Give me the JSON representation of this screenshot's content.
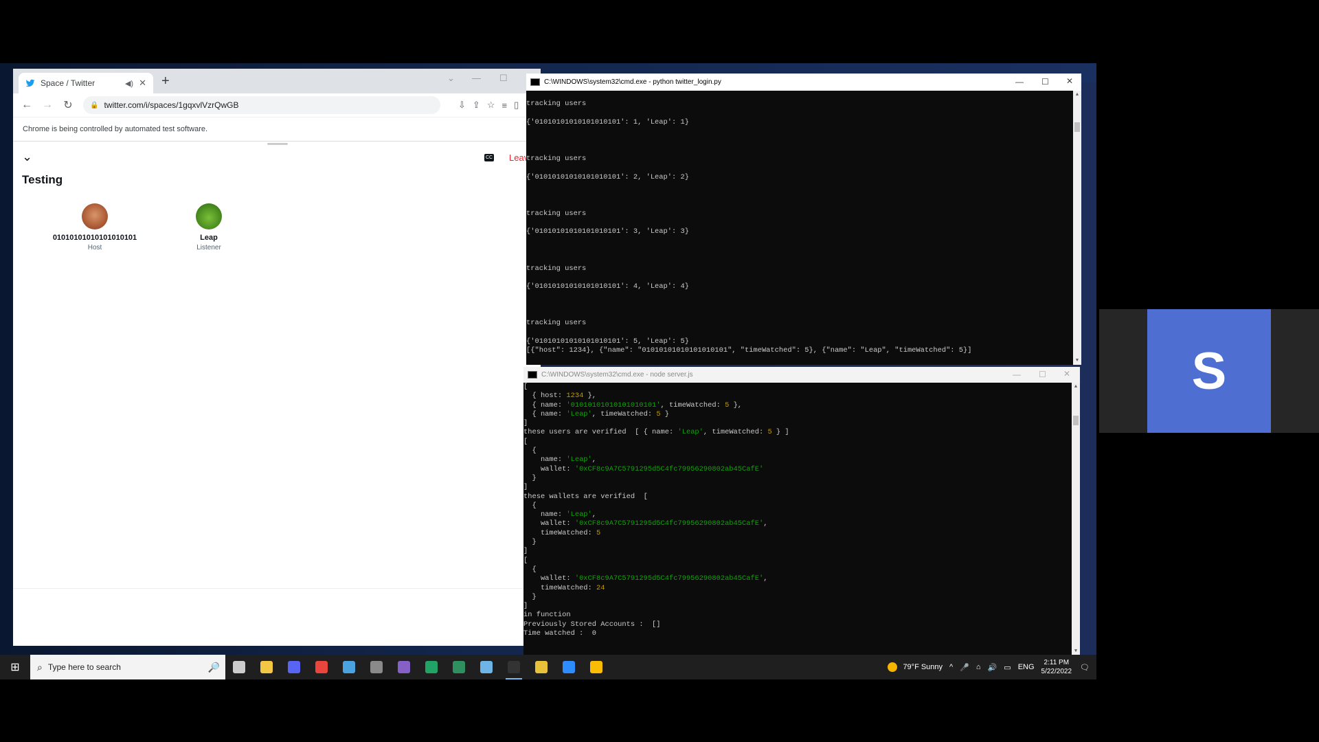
{
  "browser": {
    "tab_title": "Space / Twitter",
    "new_tab": "+",
    "url": "twitter.com/i/spaces/1gqxvlVzrQwGB",
    "infobar": "Chrome is being controlled by automated test software.",
    "space": {
      "title": "Testing",
      "leave_label": "Leave",
      "cc_label": "CC",
      "participants": [
        {
          "name": "01010101010101010101",
          "role": "Host"
        },
        {
          "name": "Leap",
          "role": "Listener"
        }
      ]
    }
  },
  "terminal_python": {
    "title": "C:\\WINDOWS\\system32\\cmd.exe - python  twitter_login.py",
    "lines": [
      "",
      "tracking users",
      "",
      "{'01010101010101010101': 1, 'Leap': 1}",
      "",
      "",
      "",
      "tracking users",
      "",
      "{'01010101010101010101': 2, 'Leap': 2}",
      "",
      "",
      "",
      "tracking users",
      "",
      "{'01010101010101010101': 3, 'Leap': 3}",
      "",
      "",
      "",
      "tracking users",
      "",
      "{'01010101010101010101': 4, 'Leap': 4}",
      "",
      "",
      "",
      "tracking users",
      "",
      "{'01010101010101010101': 5, 'Leap': 5}",
      "[{\"host\": 1234}, {\"name\": \"01010101010101010101\", \"timeWatched\": 5}, {\"name\": \"Leap\", \"timeWatched\": 5}]"
    ]
  },
  "terminal_node": {
    "title": "C:\\WINDOWS\\system32\\cmd.exe - node  server.js",
    "lines": [
      [
        {
          "t": "["
        }
      ],
      [
        {
          "t": "  { host: "
        },
        {
          "t": "1234",
          "c": "y"
        },
        {
          "t": " },"
        }
      ],
      [
        {
          "t": "  { name: "
        },
        {
          "t": "'01010101010101010101'",
          "c": "g"
        },
        {
          "t": ", timeWatched: "
        },
        {
          "t": "5",
          "c": "y"
        },
        {
          "t": " },"
        }
      ],
      [
        {
          "t": "  { name: "
        },
        {
          "t": "'Leap'",
          "c": "g"
        },
        {
          "t": ", timeWatched: "
        },
        {
          "t": "5",
          "c": "y"
        },
        {
          "t": " }"
        }
      ],
      [
        {
          "t": "]"
        }
      ],
      [
        {
          "t": "these users are verified  [ { name: "
        },
        {
          "t": "'Leap'",
          "c": "g"
        },
        {
          "t": ", timeWatched: "
        },
        {
          "t": "5",
          "c": "y"
        },
        {
          "t": " } ]"
        }
      ],
      [
        {
          "t": "["
        }
      ],
      [
        {
          "t": "  {"
        }
      ],
      [
        {
          "t": "    name: "
        },
        {
          "t": "'Leap'",
          "c": "g"
        },
        {
          "t": ","
        }
      ],
      [
        {
          "t": "    wallet: "
        },
        {
          "t": "'0xCF8c9A7C5791295d5C4fc79956290802ab45CafE'",
          "c": "g"
        }
      ],
      [
        {
          "t": "  }"
        }
      ],
      [
        {
          "t": "]"
        }
      ],
      [
        {
          "t": "these wallets are verified  ["
        }
      ],
      [
        {
          "t": "  {"
        }
      ],
      [
        {
          "t": "    name: "
        },
        {
          "t": "'Leap'",
          "c": "g"
        },
        {
          "t": ","
        }
      ],
      [
        {
          "t": "    wallet: "
        },
        {
          "t": "'0xCF8c9A7C5791295d5C4fc79956290802ab45CafE'",
          "c": "g"
        },
        {
          "t": ","
        }
      ],
      [
        {
          "t": "    timeWatched: "
        },
        {
          "t": "5",
          "c": "y"
        }
      ],
      [
        {
          "t": "  }"
        }
      ],
      [
        {
          "t": "]"
        }
      ],
      [
        {
          "t": "["
        }
      ],
      [
        {
          "t": "  {"
        }
      ],
      [
        {
          "t": "    wallet: "
        },
        {
          "t": "'0xCF8c9A7C5791295d5C4fc79956290802ab45CafE'",
          "c": "g"
        },
        {
          "t": ","
        }
      ],
      [
        {
          "t": "    timeWatched: "
        },
        {
          "t": "24",
          "c": "y"
        }
      ],
      [
        {
          "t": "  }"
        }
      ],
      [
        {
          "t": "]"
        }
      ],
      [
        {
          "t": "in function"
        }
      ],
      [
        {
          "t": "Previously Stored Accounts :  []"
        }
      ],
      [
        {
          "t": "Time watched :  0"
        }
      ]
    ]
  },
  "video_tile": {
    "initial": "S",
    "color": "#4f6ed1"
  },
  "taskbar": {
    "search_placeholder": "Type here to search",
    "apps": [
      {
        "icon": "task-view-icon",
        "color": "#cccccc"
      },
      {
        "icon": "file-explorer-icon",
        "color": "#f2c744"
      },
      {
        "icon": "discord-icon",
        "color": "#5865f2"
      },
      {
        "icon": "chrome-icon",
        "color": "#e8453c"
      },
      {
        "icon": "notepad-icon",
        "color": "#4aa3df"
      },
      {
        "icon": "game-icon",
        "color": "#8a8a8a"
      },
      {
        "icon": "visual-studio-icon",
        "color": "#8661c5"
      },
      {
        "icon": "excel-icon",
        "color": "#21a366"
      },
      {
        "icon": "spreadsheet-icon",
        "color": "#2f8f5f"
      },
      {
        "icon": "editor-icon",
        "color": "#6fb4e6"
      },
      {
        "icon": "terminal-icon",
        "color": "#333333",
        "active": true
      },
      {
        "icon": "git-icon",
        "color": "#e8c13a"
      },
      {
        "icon": "zoom-icon",
        "color": "#2d8cff"
      },
      {
        "icon": "chrome-icon-2",
        "color": "#fbbc04"
      }
    ],
    "weather": "79°F  Sunny",
    "language": "ENG",
    "time": "2:11 PM",
    "date": "5/22/2022"
  }
}
